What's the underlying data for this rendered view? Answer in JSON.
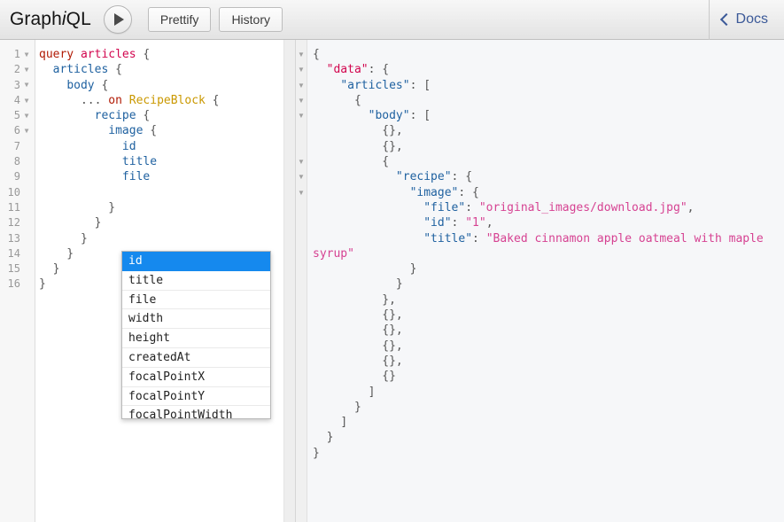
{
  "app": {
    "logo_prefix": "Graph",
    "logo_italic": "i",
    "logo_suffix": "QL"
  },
  "toolbar": {
    "execute_label": "",
    "execute_icon": "play-triangle-icon",
    "prettify_label": "Prettify",
    "history_label": "History",
    "docs_label": "Docs",
    "docs_icon": "chevron-left-icon"
  },
  "query_editor": {
    "line_numbers": [
      {
        "n": "1",
        "fold": true
      },
      {
        "n": "2",
        "fold": true
      },
      {
        "n": "3",
        "fold": true
      },
      {
        "n": "4",
        "fold": true
      },
      {
        "n": "5",
        "fold": true
      },
      {
        "n": "6",
        "fold": true
      },
      {
        "n": "7",
        "fold": false
      },
      {
        "n": "8",
        "fold": false
      },
      {
        "n": "9",
        "fold": false
      },
      {
        "n": "10",
        "fold": false
      },
      {
        "n": "11",
        "fold": false
      },
      {
        "n": "12",
        "fold": false
      },
      {
        "n": "13",
        "fold": false
      },
      {
        "n": "14",
        "fold": false
      },
      {
        "n": "15",
        "fold": false
      },
      {
        "n": "16",
        "fold": false
      }
    ],
    "fold_glyph": "▼",
    "lines": [
      [
        {
          "t": "query",
          "c": "kw"
        },
        {
          "t": " ",
          "c": "pun"
        },
        {
          "t": "articles",
          "c": "def"
        },
        {
          "t": " {",
          "c": "pun"
        }
      ],
      [
        {
          "t": "  ",
          "c": "pun"
        },
        {
          "t": "articles",
          "c": "fld"
        },
        {
          "t": " {",
          "c": "pun"
        }
      ],
      [
        {
          "t": "    ",
          "c": "pun"
        },
        {
          "t": "body",
          "c": "fld"
        },
        {
          "t": " {",
          "c": "pun"
        }
      ],
      [
        {
          "t": "      ... ",
          "c": "pun"
        },
        {
          "t": "on",
          "c": "kw"
        },
        {
          "t": " ",
          "c": "pun"
        },
        {
          "t": "RecipeBlock",
          "c": "type"
        },
        {
          "t": " {",
          "c": "pun"
        }
      ],
      [
        {
          "t": "        ",
          "c": "pun"
        },
        {
          "t": "recipe",
          "c": "fld"
        },
        {
          "t": " {",
          "c": "pun"
        }
      ],
      [
        {
          "t": "          ",
          "c": "pun"
        },
        {
          "t": "image",
          "c": "fld"
        },
        {
          "t": " {",
          "c": "pun"
        }
      ],
      [
        {
          "t": "            ",
          "c": "pun"
        },
        {
          "t": "id",
          "c": "fld"
        }
      ],
      [
        {
          "t": "            ",
          "c": "pun"
        },
        {
          "t": "title",
          "c": "fld"
        }
      ],
      [
        {
          "t": "            ",
          "c": "pun"
        },
        {
          "t": "file",
          "c": "fld"
        }
      ],
      [
        {
          "t": "",
          "c": "pun"
        }
      ],
      [
        {
          "t": "          }",
          "c": "pun"
        }
      ],
      [
        {
          "t": "        }",
          "c": "pun"
        }
      ],
      [
        {
          "t": "      }",
          "c": "pun"
        }
      ],
      [
        {
          "t": "    }",
          "c": "pun"
        }
      ],
      [
        {
          "t": "  }",
          "c": "pun"
        }
      ],
      [
        {
          "t": "}",
          "c": "pun"
        }
      ]
    ]
  },
  "autocomplete": {
    "items": [
      {
        "label": "id",
        "selected": true
      },
      {
        "label": "title",
        "selected": false
      },
      {
        "label": "file",
        "selected": false
      },
      {
        "label": "width",
        "selected": false
      },
      {
        "label": "height",
        "selected": false
      },
      {
        "label": "createdAt",
        "selected": false
      },
      {
        "label": "focalPointX",
        "selected": false
      },
      {
        "label": "focalPointY",
        "selected": false
      },
      {
        "label": "focalPointWidth",
        "selected": false
      }
    ]
  },
  "result_panel": {
    "fold_glyph": "▼",
    "fold_rows": [
      true,
      true,
      true,
      true,
      true,
      false,
      false,
      true,
      true,
      true,
      false,
      false,
      false,
      false,
      false,
      false,
      false,
      false,
      false,
      false,
      false,
      false,
      false,
      false,
      false,
      false,
      false
    ],
    "lines": [
      [
        {
          "t": "{",
          "c": "pun"
        }
      ],
      [
        {
          "t": "  ",
          "c": "pun"
        },
        {
          "t": "\"data\"",
          "c": "key-top"
        },
        {
          "t": ": {",
          "c": "pun"
        }
      ],
      [
        {
          "t": "    ",
          "c": "pun"
        },
        {
          "t": "\"articles\"",
          "c": "key"
        },
        {
          "t": ": [",
          "c": "pun"
        }
      ],
      [
        {
          "t": "      {",
          "c": "pun"
        }
      ],
      [
        {
          "t": "        ",
          "c": "pun"
        },
        {
          "t": "\"body\"",
          "c": "key"
        },
        {
          "t": ": [",
          "c": "pun"
        }
      ],
      [
        {
          "t": "          {},",
          "c": "pun"
        }
      ],
      [
        {
          "t": "          {},",
          "c": "pun"
        }
      ],
      [
        {
          "t": "          {",
          "c": "pun"
        }
      ],
      [
        {
          "t": "            ",
          "c": "pun"
        },
        {
          "t": "\"recipe\"",
          "c": "key"
        },
        {
          "t": ": {",
          "c": "pun"
        }
      ],
      [
        {
          "t": "              ",
          "c": "pun"
        },
        {
          "t": "\"image\"",
          "c": "key"
        },
        {
          "t": ": {",
          "c": "pun"
        }
      ],
      [
        {
          "t": "                ",
          "c": "pun"
        },
        {
          "t": "\"file\"",
          "c": "key"
        },
        {
          "t": ": ",
          "c": "pun"
        },
        {
          "t": "\"original_images/download.jpg\"",
          "c": "str"
        },
        {
          "t": ",",
          "c": "pun"
        }
      ],
      [
        {
          "t": "                ",
          "c": "pun"
        },
        {
          "t": "\"id\"",
          "c": "key"
        },
        {
          "t": ": ",
          "c": "pun"
        },
        {
          "t": "\"1\"",
          "c": "str"
        },
        {
          "t": ",",
          "c": "pun"
        }
      ],
      [
        {
          "t": "                ",
          "c": "pun"
        },
        {
          "t": "\"title\"",
          "c": "key"
        },
        {
          "t": ": ",
          "c": "pun"
        },
        {
          "t": "\"Baked cinnamon apple oatmeal with maple syrup\"",
          "c": "str"
        }
      ],
      [
        {
          "t": "              }",
          "c": "pun"
        }
      ],
      [
        {
          "t": "            }",
          "c": "pun"
        }
      ],
      [
        {
          "t": "          },",
          "c": "pun"
        }
      ],
      [
        {
          "t": "          {},",
          "c": "pun"
        }
      ],
      [
        {
          "t": "          {},",
          "c": "pun"
        }
      ],
      [
        {
          "t": "          {},",
          "c": "pun"
        }
      ],
      [
        {
          "t": "          {},",
          "c": "pun"
        }
      ],
      [
        {
          "t": "          {}",
          "c": "pun"
        }
      ],
      [
        {
          "t": "        ]",
          "c": "pun"
        }
      ],
      [
        {
          "t": "      }",
          "c": "pun"
        }
      ],
      [
        {
          "t": "    ]",
          "c": "pun"
        }
      ],
      [
        {
          "t": "  }",
          "c": "pun"
        }
      ],
      [
        {
          "t": "}",
          "c": "pun"
        }
      ]
    ]
  },
  "colors": {
    "accent_blue": "#1589ee",
    "docs_link": "#3b5998",
    "keyword_red": "#b11a04",
    "definition_pink": "#d2054e",
    "field_blue": "#1f61a0",
    "type_gold": "#ca9800",
    "string_pink": "#d64292"
  }
}
